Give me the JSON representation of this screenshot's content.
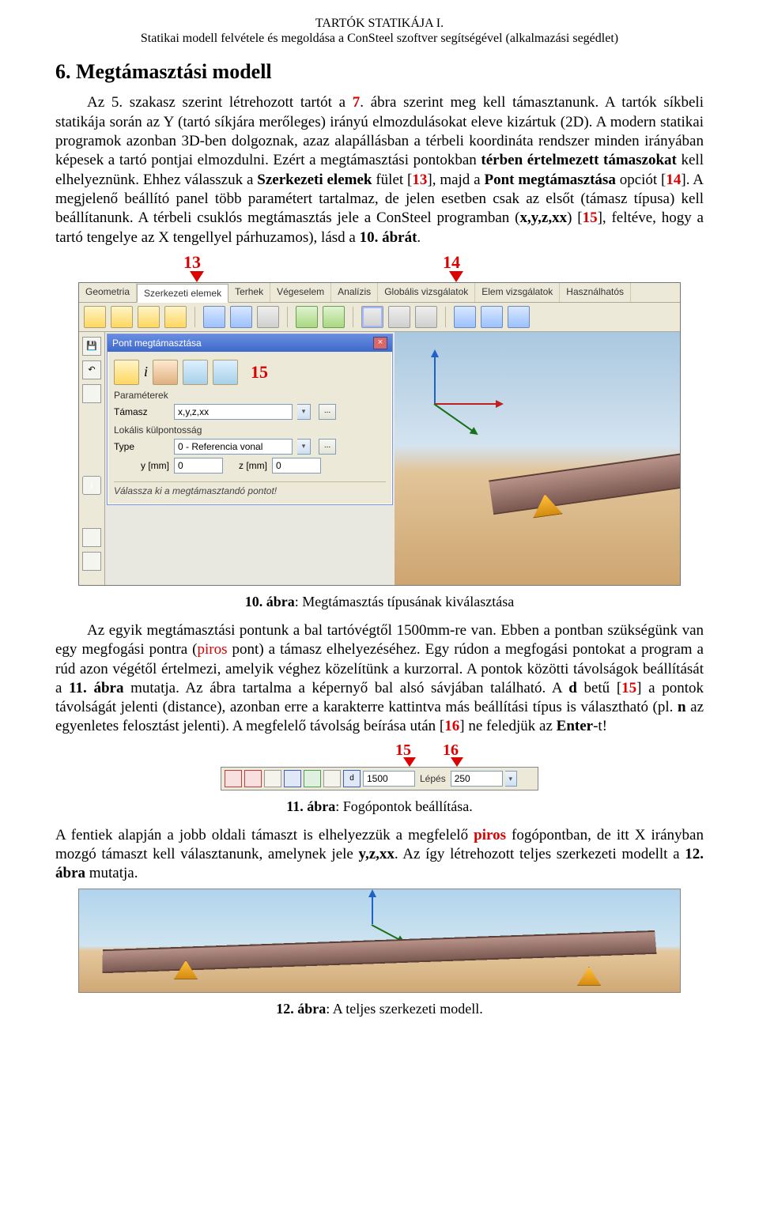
{
  "header": {
    "line1": "TARTÓK STATIKÁJA I.",
    "line2": "Statikai modell felvétele és megoldása a ConSteel szoftver segítségével (alkalmazási segédlet)"
  },
  "section_title": "6. Megtámasztási modell",
  "para1_pre": "Az 5. szakasz szerint létrehozott tartót a ",
  "para1_ref7": "7",
  "para1_post": ". ábra szerint meg kell támasztanunk. A tartók síkbeli statikája során az Y (tartó síkjára merőleges) irányú elmozdulásokat eleve kizártuk (2D). A modern statikai programok azonban 3D-ben dolgoznak, azaz alapállásban a térbeli koordináta rendszer minden irányában képesek a tartó pontjai elmozdulni. Ezért a megtámasztási pontokban ",
  "para1_bold1": "térben értelmezett támaszokat",
  "para1_mid1": " kell elhelyeznünk. Ehhez válasszuk a ",
  "para1_bold2": "Szerkezeti elemek",
  "para1_mid2": " fület [",
  "para1_ref13": "13",
  "para1_mid3": "], majd a ",
  "para1_bold3": "Pont megtámasztása",
  "para1_mid4": " opciót [",
  "para1_ref14": "14",
  "para1_mid5": "]. A megjelenő beállító panel több paramétert tartalmaz, de jelen esetben csak az elsőt (támasz típusa) kell beállítanunk. A térbeli csuklós megtámasztás jele a ConSteel programban (",
  "para1_bold4": "x,y,z,xx",
  "para1_mid6": ") [",
  "para1_ref15": "15",
  "para1_mid7": "], feltéve, hogy a tartó tengelye az X tengellyel párhuzamos), lásd a ",
  "para1_bold5": "10. ábrát",
  "para1_end": ".",
  "markers": {
    "m13": "13",
    "m14": "14",
    "m15": "15",
    "m16": "16"
  },
  "shot1": {
    "tabs": [
      "Geometria",
      "Szerkezeti elemek",
      "Terhek",
      "Végeselem",
      "Analízis",
      "Globális vizsgálatok",
      "Elem vizsgálatok",
      "Használhatós"
    ],
    "panel_title": "Pont megtámasztása",
    "param_label": "Paraméterek",
    "tamasz_label": "Támasz",
    "tamasz_value": "x,y,z,xx",
    "lokalis_label": "Lokális külpontosság",
    "type_label": "Type",
    "type_value": "0 - Referencia vonal",
    "y_label": "y [mm]",
    "y_value": "0",
    "z_label": "z [mm]",
    "z_value": "0",
    "hint": "Válassza ki a megtámasztandó pontot!",
    "info_i": "i"
  },
  "fig10_cap_b": "10. ábra",
  "fig10_cap_r": ": Megtámasztás típusának kiválasztása",
  "para2_pre": "Az egyik megtámasztási pontunk a bal tartóvégtől 1500mm-re van. Ebben a pontban szükségünk van egy megfogási pontra (",
  "para2_piros1": "piros",
  "para2_mid1": " pont) a támasz elhelyezéséhez. Egy rúdon a megfogási pontokat a program a rúd azon végétől értelmezi, amelyik véghez közelítünk a kurzorral. A pontok közötti távolságok beállítását a ",
  "para2_b1": "11. ábra",
  "para2_mid2": " mutatja. Az ábra tartalma a képernyő bal alsó sávjában található. A ",
  "para2_b2": "d",
  "para2_mid3": " betű [",
  "para2_ref15": "15",
  "para2_mid4": "] a pontok távolságát jelenti (distance), azonban erre a karakterre kattintva más beállítási típus is választható (pl. ",
  "para2_b3": "n",
  "para2_mid5": " az egyenletes felosztást jelenti). A megfelelő távolság beírása után [",
  "para2_ref16": "16",
  "para2_mid6": "] ne feledjük az ",
  "para2_b4": "Enter",
  "para2_end": "-t!",
  "shot2": {
    "d_btn": "d",
    "d_value": "1500",
    "step_label": "Lépés",
    "step_value": "250"
  },
  "fig11_cap_b": "11. ábra",
  "fig11_cap_r": ": Fogópontok beállítása.",
  "para3_pre": "A fentiek alapján a jobb oldali támaszt is elhelyezzük a megfelelő ",
  "para3_piros": "piros",
  "para3_mid1": " fogópontban, de itt X irányban mozgó támaszt kell választanunk, amelynek jele ",
  "para3_b1": "y,z,xx",
  "para3_mid2": ". Az így létrehozott teljes szerkezeti modellt a ",
  "para3_b2": "12. ábra",
  "para3_end": " mutatja.",
  "fig12_cap_b": "12. ábra",
  "fig12_cap_r": ": A teljes szerkezeti modell."
}
